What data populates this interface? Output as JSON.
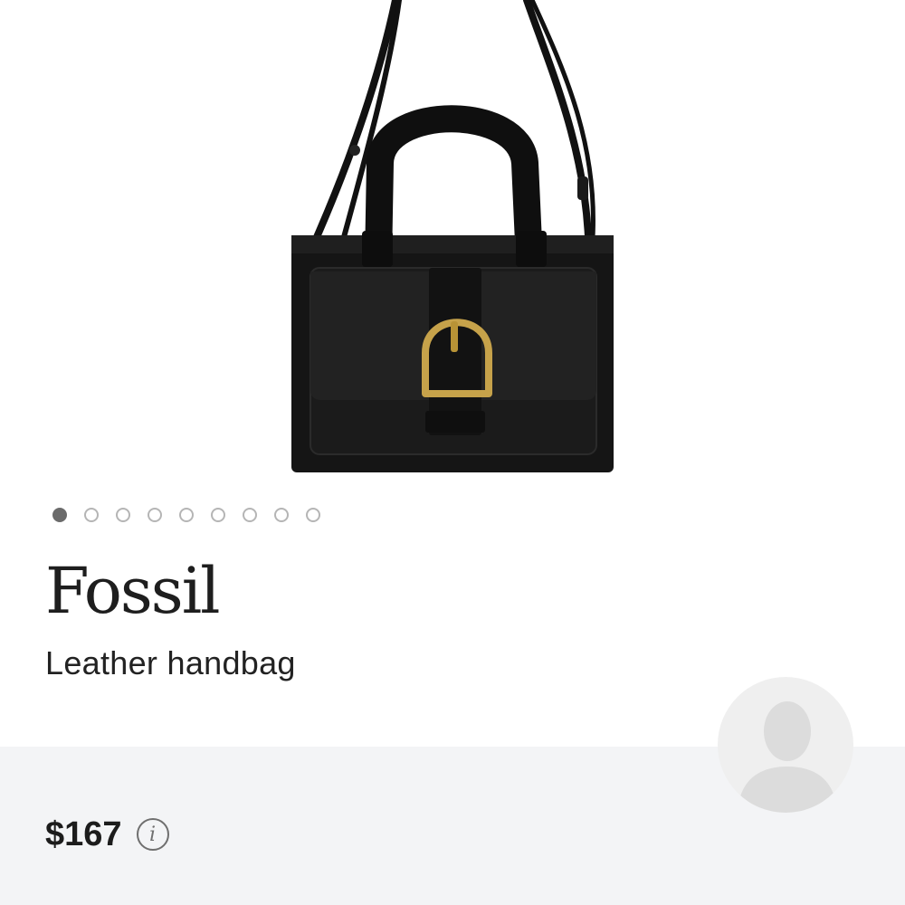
{
  "product": {
    "brand": "Fossil",
    "description": "Leather handbag",
    "price": "$167",
    "image_alt": "Black leather handbag with gold buckle"
  },
  "carousel": {
    "total_images": 9,
    "active_index": 0
  },
  "icons": {
    "info": "info-icon",
    "avatar": "user-avatar-placeholder-icon"
  },
  "colors": {
    "bar_background": "#f3f4f6",
    "dot_active": "#6b6b6b",
    "dot_inactive": "#b5b5b5"
  }
}
